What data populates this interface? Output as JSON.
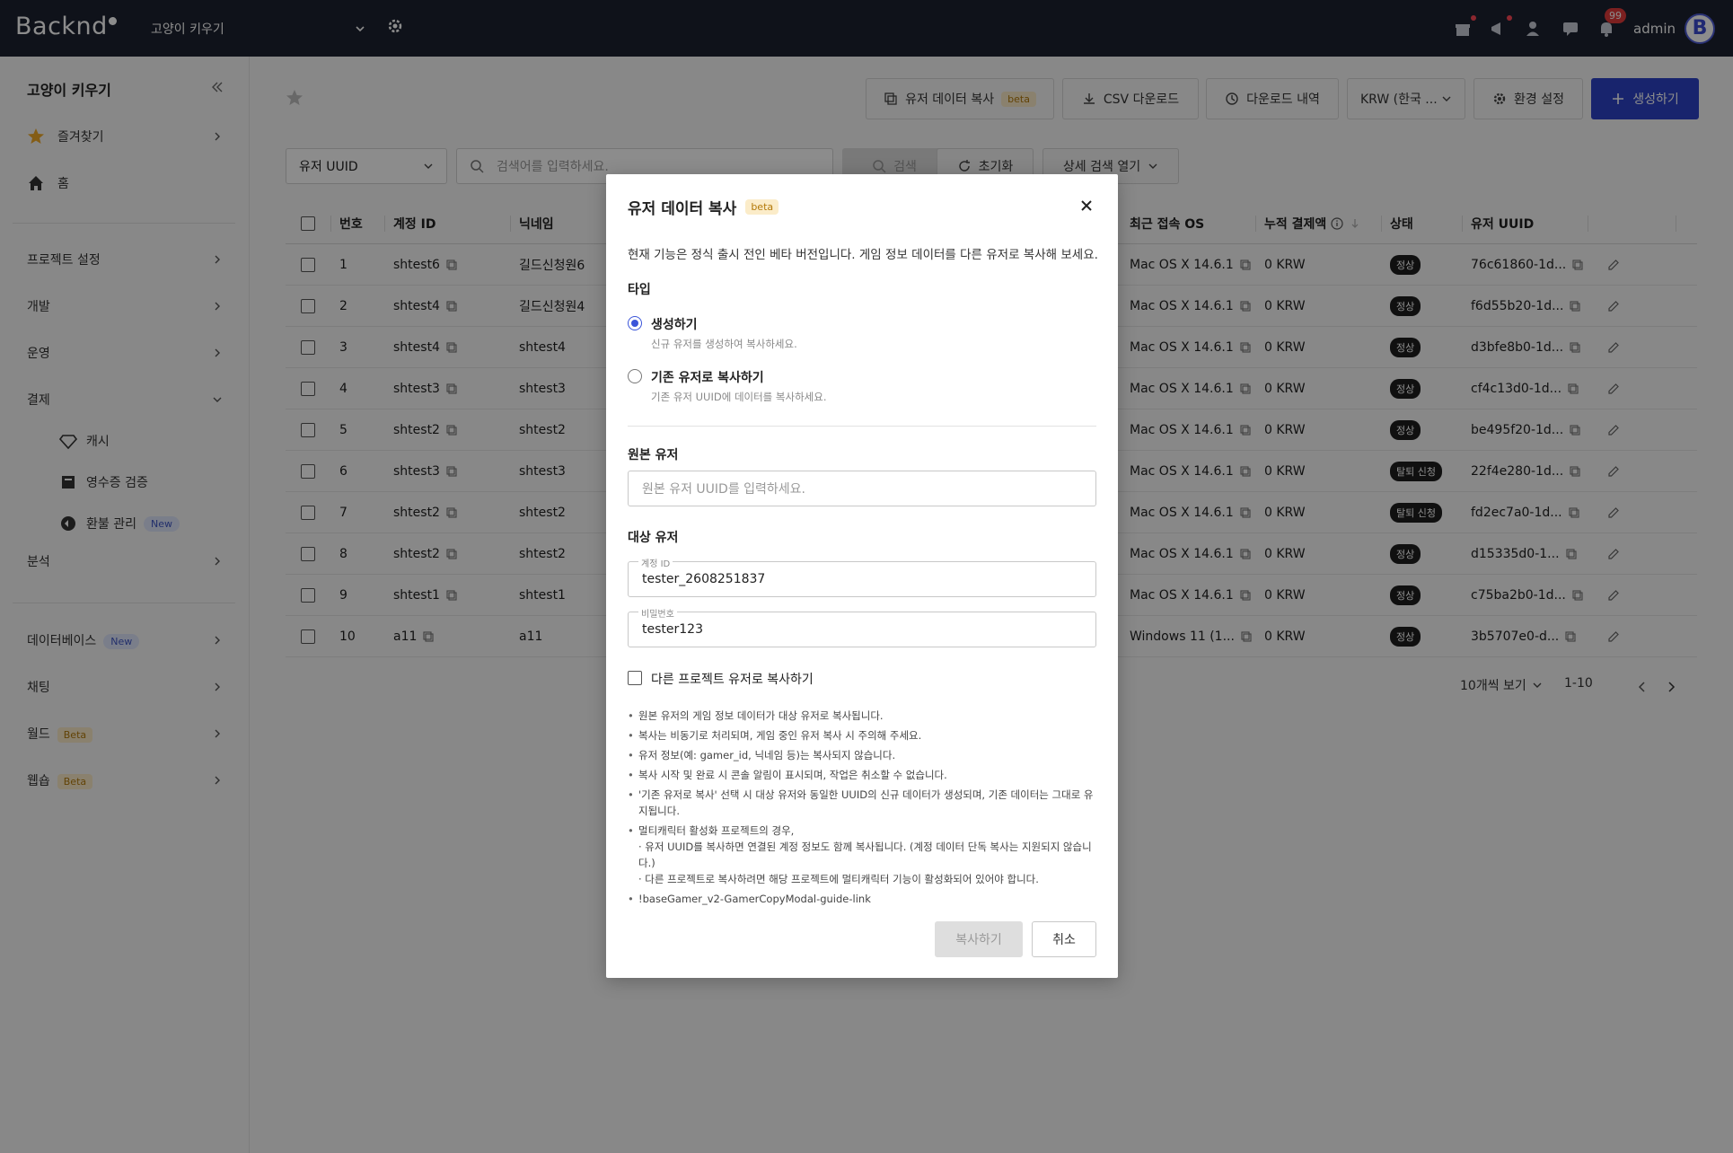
{
  "topbar": {
    "logo": "Backnd",
    "project": "고양이 키우기",
    "notif_count": "99",
    "user": "admin",
    "avatar_letter": "B"
  },
  "sidebar": {
    "title": "고양이 키우기",
    "favorites": "즐겨찾기",
    "home": "홈",
    "project_settings": "프로젝트 설정",
    "dev": "개발",
    "ops": "운영",
    "payment": "결제",
    "cash": "캐시",
    "receipt": "영수증 검증",
    "refund": "환불 관리",
    "refund_tag": "New",
    "analytics": "분석",
    "database": "데이터베이스",
    "database_tag": "New",
    "chat": "채팅",
    "world": "월드",
    "world_tag": "Beta",
    "webshop": "웹숍",
    "webshop_tag": "Beta"
  },
  "toolbar": {
    "copy_user": "유저 데이터 복사",
    "copy_beta": "beta",
    "csv": "CSV 다운로드",
    "history": "다운로드 내역",
    "currency": "KRW (한국 ...",
    "settings": "환경 설정",
    "create": "생성하기"
  },
  "filter": {
    "field": "유저 UUID",
    "placeholder": "검색어를 입력하세요.",
    "search": "검색",
    "reset": "초기화",
    "advanced": "상세 검색 열기"
  },
  "table": {
    "headers": {
      "no": "번호",
      "account": "계정 ID",
      "nickname": "닉네임",
      "os": "최근 접속 OS",
      "payment": "누적 결제액",
      "status": "상태",
      "uuid": "유저 UUID"
    },
    "rows": [
      {
        "no": "1",
        "account": "shtest6",
        "nickname": "길드신청원6",
        "os": "Mac OS X 14.6.1",
        "pay": "0 KRW",
        "status": "정상",
        "uuid": "76c61860-1d..."
      },
      {
        "no": "2",
        "account": "shtest4",
        "nickname": "길드신청원4",
        "os": "Mac OS X 14.6.1",
        "pay": "0 KRW",
        "status": "정상",
        "uuid": "f6d55b20-1d..."
      },
      {
        "no": "3",
        "account": "shtest4",
        "nickname": "shtest4",
        "os": "Mac OS X 14.6.1",
        "pay": "0 KRW",
        "status": "정상",
        "uuid": "d3bfe8b0-1d..."
      },
      {
        "no": "4",
        "account": "shtest3",
        "nickname": "shtest3",
        "os": "Mac OS X 14.6.1",
        "pay": "0 KRW",
        "status": "정상",
        "uuid": "cf4c13d0-1d..."
      },
      {
        "no": "5",
        "account": "shtest2",
        "nickname": "shtest2",
        "os": "Mac OS X 14.6.1",
        "pay": "0 KRW",
        "status": "정상",
        "uuid": "be495f20-1d..."
      },
      {
        "no": "6",
        "account": "shtest3",
        "nickname": "shtest3",
        "os": "Mac OS X 14.6.1",
        "pay": "0 KRW",
        "status": "탈퇴 신청",
        "uuid": "22f4e280-1d..."
      },
      {
        "no": "7",
        "account": "shtest2",
        "nickname": "shtest2",
        "os": "Mac OS X 14.6.1",
        "pay": "0 KRW",
        "status": "탈퇴 신청",
        "uuid": "fd2ec7a0-1d..."
      },
      {
        "no": "8",
        "account": "shtest2",
        "nickname": "shtest2",
        "os": "Mac OS X 14.6.1",
        "pay": "0 KRW",
        "status": "정상",
        "uuid": "d15335d0-1..."
      },
      {
        "no": "9",
        "account": "shtest1",
        "nickname": "shtest1",
        "os": "Mac OS X 14.6.1",
        "pay": "0 KRW",
        "status": "정상",
        "uuid": "c75ba2b0-1d..."
      },
      {
        "no": "10",
        "account": "a11",
        "nickname": "a11",
        "os": "Windows 11 (1...",
        "pay": "0 KRW",
        "status": "정상",
        "uuid": "3b5707e0-d..."
      }
    ]
  },
  "pagination": {
    "per_page": "10개씩 보기",
    "range": "1-10"
  },
  "modal": {
    "title": "유저 데이터 복사",
    "beta": "beta",
    "desc": "현재 기능은 정식 출시 전인 베타 버전입니다. 게임 정보 데이터를 다른 유저로 복사해 보세요.",
    "type_label": "타입",
    "opt1_title": "생성하기",
    "opt1_sub": "신규 유저를 생성하여 복사하세요.",
    "opt2_title": "기존 유저로 복사하기",
    "opt2_sub": "기존 유저 UUID에 데이터를 복사하세요.",
    "source_label": "원본 유저",
    "source_placeholder": "원본 유저 UUID를 입력하세요.",
    "target_label": "대상 유저",
    "account_float": "계정 ID",
    "account_value": "tester_2608251837",
    "password_float": "비밀번호",
    "password_value": "tester123",
    "other_project": "다른 프로젝트 유저로 복사하기",
    "notes": [
      "원본 유저의 게임 정보 데이터가 대상 유저로 복사됩니다.",
      "복사는 비동기로 처리되며, 게임 중인 유저 복사 시 주의해 주세요.",
      "유저 정보(예: gamer_id, 닉네임 등)는 복사되지 않습니다.",
      "복사 시작 및 완료 시 콘솔 알림이 표시되며, 작업은 취소할 수 없습니다.",
      "'기존 유저로 복사' 선택 시 대상 유저와 동일한 UUID의 신규 데이터가 생성되며, 기존 데이터는 그대로 유지됩니다."
    ],
    "note_multi": "멀티캐릭터 활성화 프로젝트의 경우,",
    "note_multi_a": "· 유저 UUID를 복사하면 연결된 계정 정보도 함께 복사됩니다. (계정 데이터 단독 복사는 지원되지 않습니다.)",
    "note_multi_b": "· 다른 프로젝트로 복사하려면 해당 프로젝트에 멀티캐릭터 기능이 활성화되어 있어야 합니다.",
    "note_link": "!baseGamer_v2-GamerCopyModal-guide-link",
    "copy_btn": "복사하기",
    "cancel_btn": "취소"
  },
  "colors": {
    "topbar": "#1c2130",
    "primary": "#2d43c6",
    "radio": "#3b55d9"
  }
}
